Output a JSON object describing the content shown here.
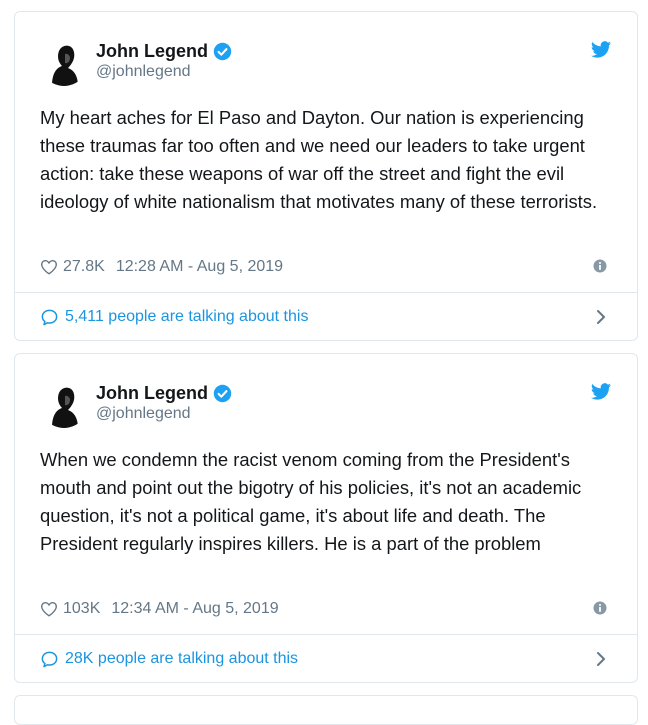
{
  "colors": {
    "text": "#14171a",
    "muted": "#657786",
    "accent": "#1b95e0",
    "twitter_blue": "#1da1f2",
    "border": "#e1e8ed"
  },
  "tweets": [
    {
      "author_name": "John Legend",
      "author_handle": "@johnlegend",
      "text": "My heart aches for El Paso and Dayton. Our nation is experiencing these traumas far too often and we need our leaders to take urgent action: take these weapons of war off the street and fight the evil ideology of white nationalism that motivates many of these terrorists.",
      "likes": "27.8K",
      "timestamp": "12:28 AM - Aug 5, 2019",
      "talking": "5,411 people are talking about this"
    },
    {
      "author_name": "John Legend",
      "author_handle": "@johnlegend",
      "text": "When we condemn the racist venom coming from the President's mouth and point out the bigotry of his policies, it's not an academic question, it's not a political game, it's about life and death. The President regularly inspires killers. He is a part of the problem",
      "likes": "103K",
      "timestamp": "12:34 AM - Aug 5, 2019",
      "talking": "28K people are talking about this"
    }
  ],
  "icons": {
    "verified": "verified-badge-icon",
    "bird": "twitter-bird-icon",
    "heart": "heart-icon",
    "info": "info-icon",
    "bubble": "speech-bubble-icon",
    "chevron": "chevron-right-icon"
  }
}
